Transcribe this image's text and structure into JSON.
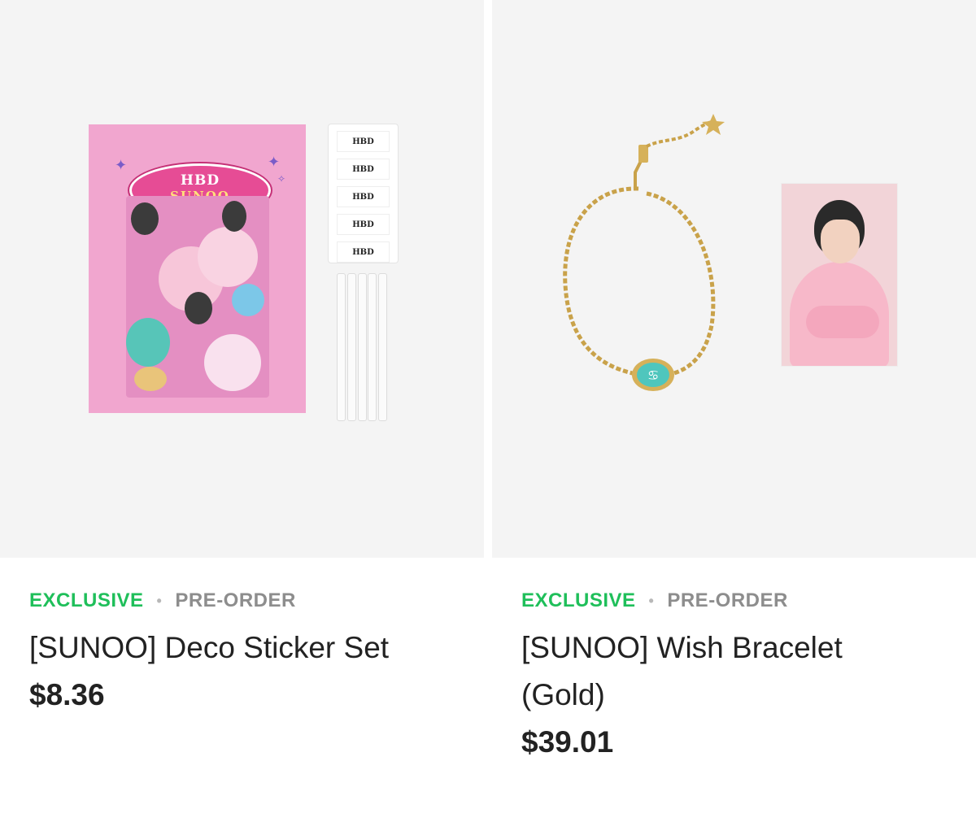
{
  "products": [
    {
      "image_alt": "",
      "tag_primary": "EXCLUSIVE",
      "tag_separator": "•",
      "tag_secondary": "PRE-ORDER",
      "title": "[SUNOO] Deco Sticker Set",
      "price": "$8.36",
      "artwork": {
        "badge_line1": "HBD",
        "badge_line2": "SUNOO",
        "sticker_rows": [
          "HBD",
          "HBD",
          "HBD",
          "HBD",
          "HBD"
        ]
      }
    },
    {
      "image_alt": "",
      "tag_primary": "EXCLUSIVE",
      "tag_separator": "•",
      "tag_secondary": "PRE-ORDER",
      "title": "[SUNOO] Wish Bracelet (Gold)",
      "price": "$39.01"
    }
  ],
  "colors": {
    "exclusive": "#1fbf5a",
    "preorder": "#8d8d8d",
    "thumb_bg": "#f4f4f4",
    "text": "#222222"
  }
}
